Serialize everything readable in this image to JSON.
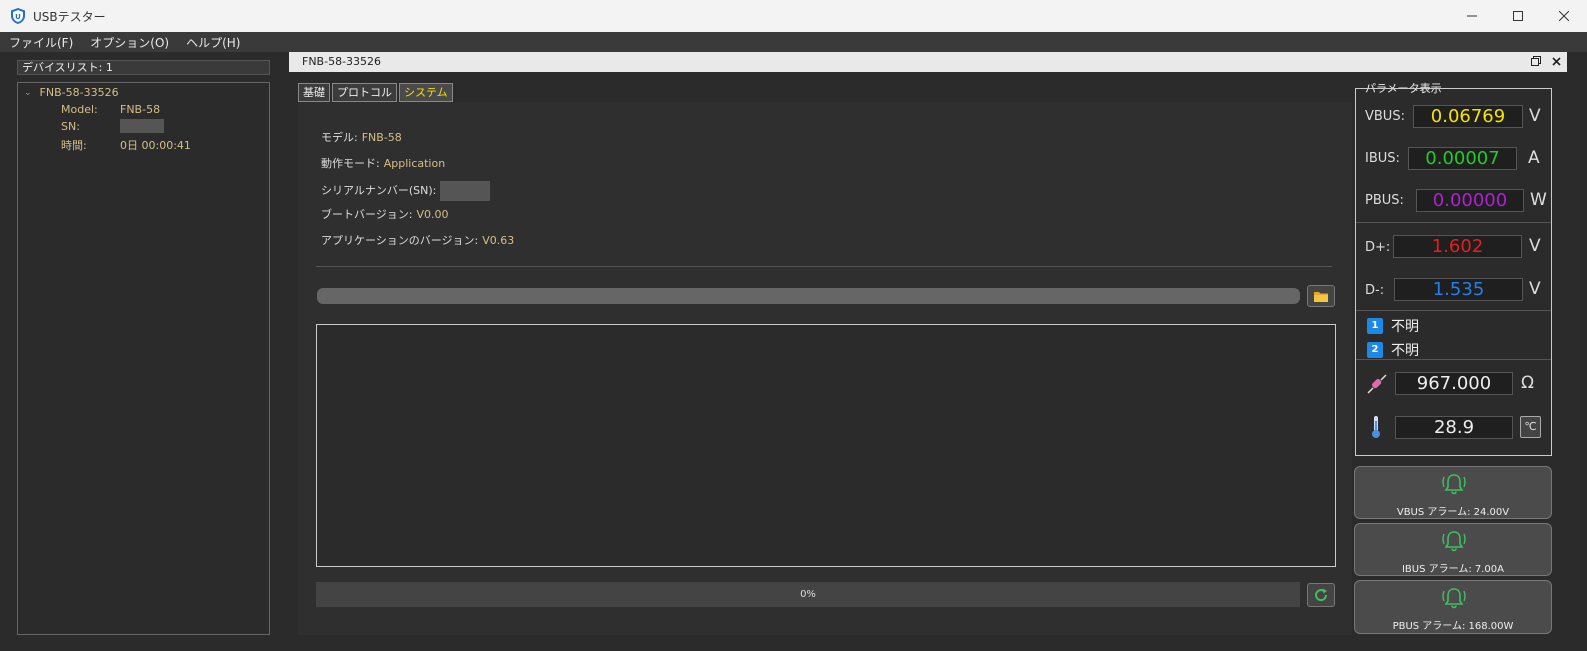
{
  "window": {
    "title": "USBテスター"
  },
  "menu": {
    "items": [
      "ファイル(F)",
      "オプション(O)",
      "ヘルプ(H)"
    ]
  },
  "device_list": {
    "header": "デバイスリスト: 1",
    "device_name": "FNB-58-33526",
    "model_label": "Model:",
    "model_value": "FNB-58",
    "sn_label": "SN:",
    "time_label": "時間:",
    "time_value": "0日 00:00:41"
  },
  "doc": {
    "title": "FNB-58-33526"
  },
  "tabs": [
    "基礎",
    "プロトコル",
    "システム"
  ],
  "system": {
    "model_label": "モデル:",
    "model_value": "FNB-58",
    "mode_label": "動作モード:",
    "mode_value": "Application",
    "serial_label": "シリアルナンバー(SN):",
    "boot_label": "ブートバージョン:",
    "boot_value": "V0.00",
    "app_label": "アプリケーションのバージョン:",
    "app_value": "V0.63",
    "progress_text": "0%",
    "progress_value": 0
  },
  "params": {
    "legend": "パラメータ表示",
    "vbus": {
      "label": "VBUS:",
      "value": "0.06769",
      "unit": "V",
      "color": "#f5e300"
    },
    "ibus": {
      "label": "IBUS:",
      "value": "0.00007",
      "unit": "A",
      "color": "#22cc22"
    },
    "pbus": {
      "label": "PBUS:",
      "value": "0.00000",
      "unit": "W",
      "color": "#b020d0"
    },
    "dplus": {
      "label": "D+:",
      "value": "1.602",
      "unit": "V",
      "color": "#e02020"
    },
    "dminus": {
      "label": "D-:",
      "value": "1.535",
      "unit": "V",
      "color": "#2080f0"
    },
    "cc1": {
      "badge": "1",
      "text": "不明"
    },
    "cc2": {
      "badge": "2",
      "text": "不明"
    },
    "resistance": {
      "value": "967.000",
      "unit": "Ω",
      "icon": "resistor-icon"
    },
    "temperature": {
      "value": "28.9",
      "unit": "℃",
      "icon": "thermometer-icon"
    }
  },
  "alarms": [
    {
      "label": "VBUS アラーム: 24.00V"
    },
    {
      "label": "IBUS アラーム: 7.00A"
    },
    {
      "label": "PBUS アラーム: 168.00W"
    }
  ]
}
